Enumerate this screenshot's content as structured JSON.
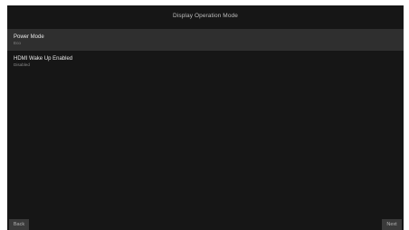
{
  "header": {
    "title": "Display Operation Mode"
  },
  "settings": [
    {
      "title": "Power Mode",
      "value": "Eco",
      "selected": true
    },
    {
      "title": "HDMI Wake Up Enabled",
      "value": "Disabled",
      "selected": false
    }
  ],
  "footer": {
    "back_label": "Back",
    "next_label": "Next"
  },
  "colors": {
    "background": "#161616",
    "selected_row": "#2f2f2f",
    "button": "#3a3a3a"
  }
}
